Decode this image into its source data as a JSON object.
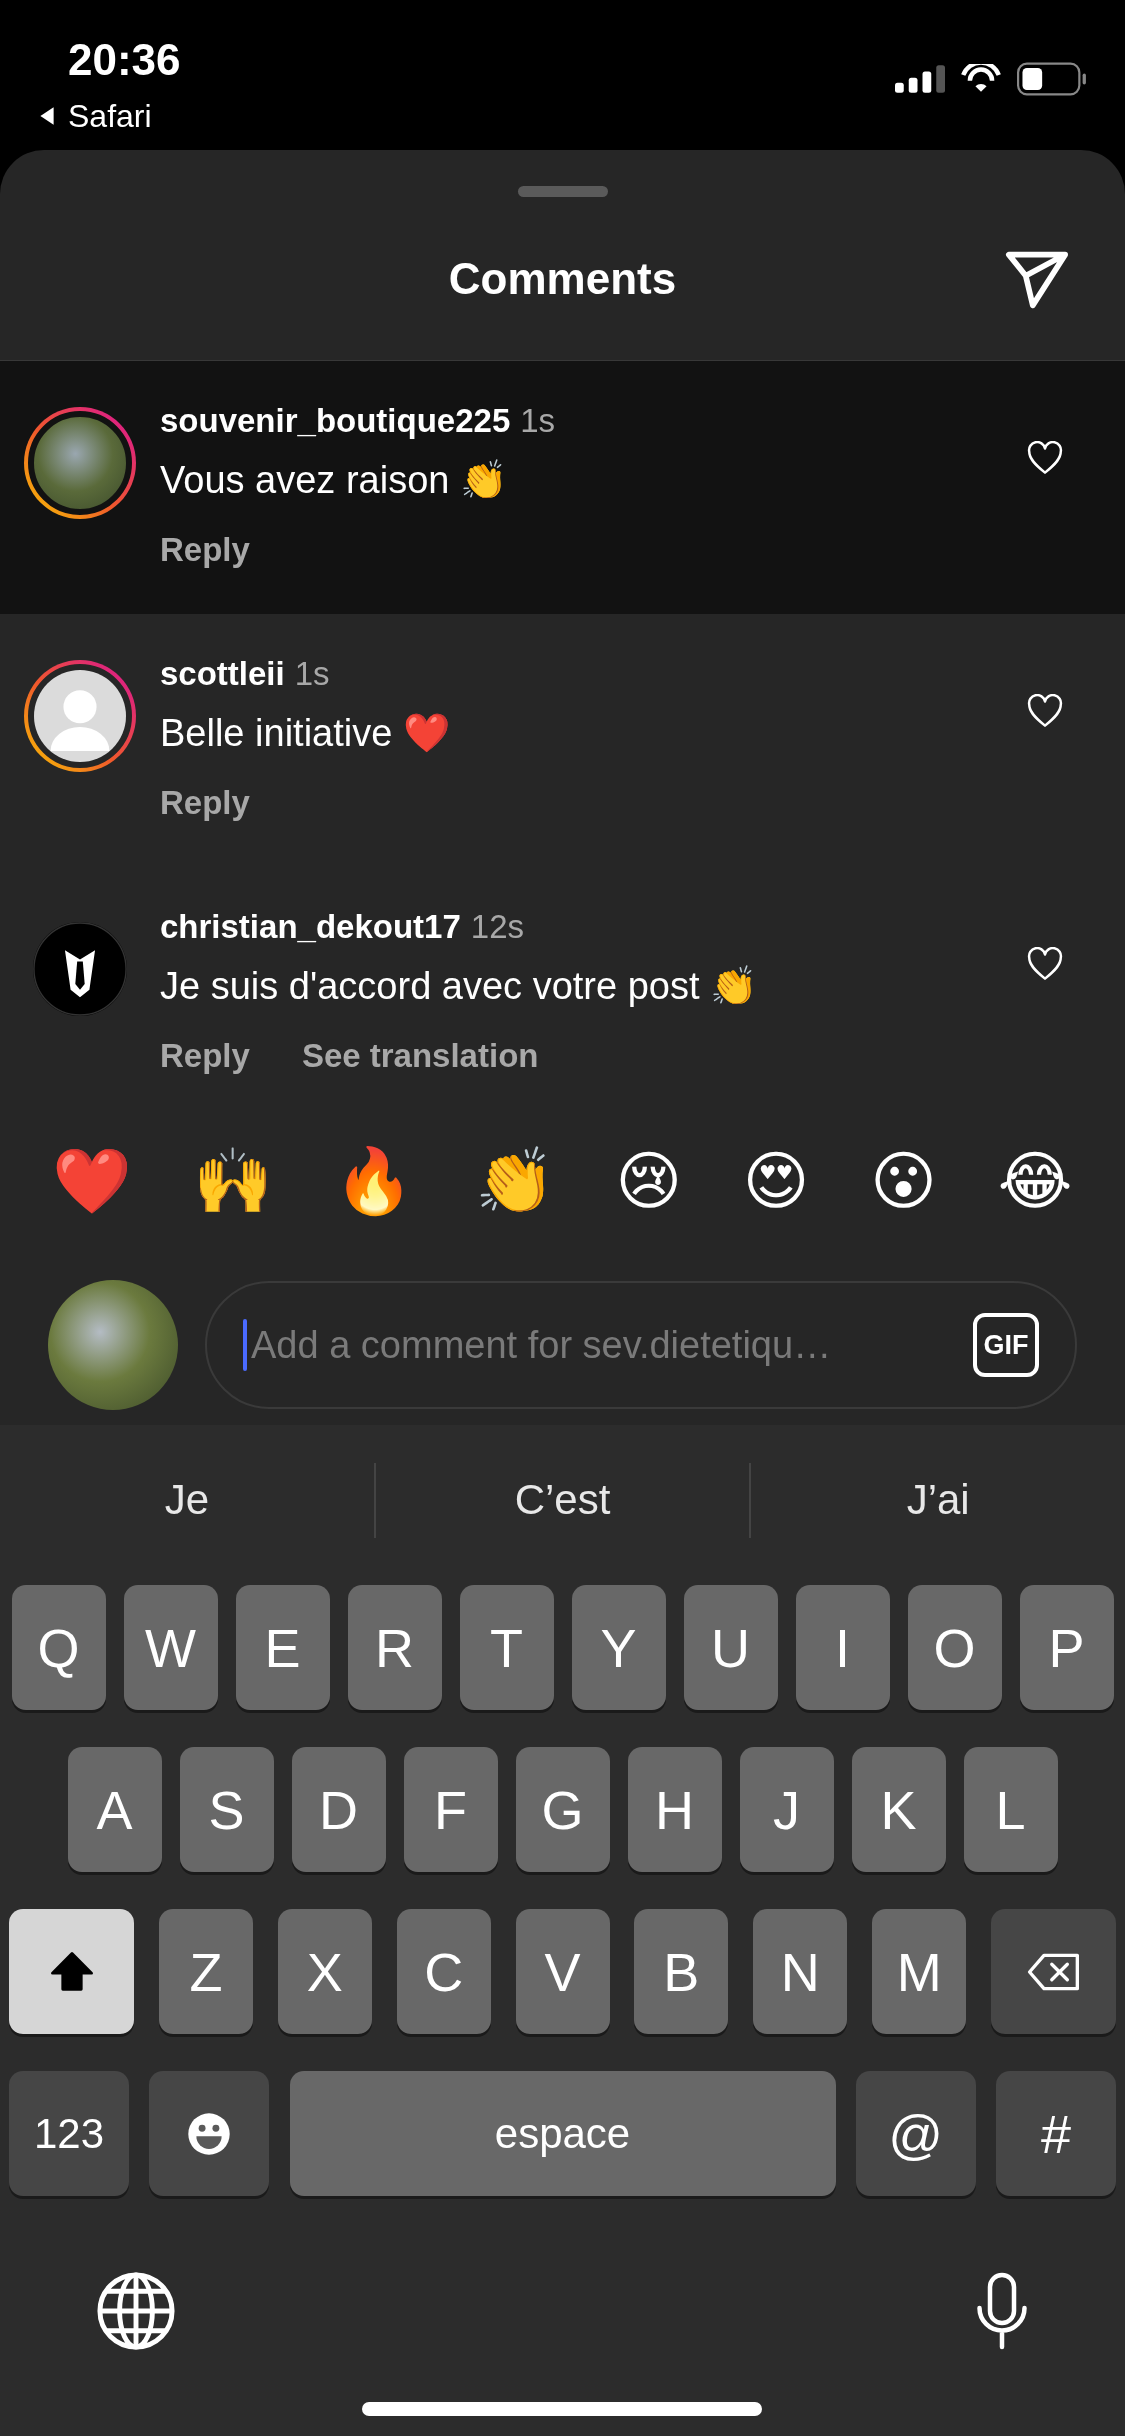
{
  "status_bar": {
    "time": "20:36",
    "back_app": "Safari"
  },
  "sheet": {
    "title": "Comments"
  },
  "comments": [
    {
      "username": "souvenir_boutique225",
      "time": "1s",
      "text": "Vous avez raison 👏",
      "actions": [
        "Reply"
      ],
      "highlighted": true,
      "avatar": {
        "kind": "photo"
      },
      "story_ring": true
    },
    {
      "username": "scottleii",
      "time": "1s",
      "text": "Belle initiative ❤️",
      "actions": [
        "Reply"
      ],
      "highlighted": false,
      "avatar": {
        "kind": "default"
      },
      "story_ring": true
    },
    {
      "username": "christian_dekout17",
      "time": "12s",
      "text": "Je suis d'accord avec votre post 👏",
      "actions": [
        "Reply",
        "See translation"
      ],
      "highlighted": false,
      "avatar": {
        "kind": "logo"
      },
      "story_ring": false
    }
  ],
  "reactions": [
    "❤️",
    "🙌",
    "🔥",
    "👏",
    "😢",
    "😍",
    "😮",
    "😂"
  ],
  "composer": {
    "placeholder": "Add a comment for sev.dietetiqu…",
    "gif_label": "GIF"
  },
  "keyboard": {
    "suggestions": [
      "Je",
      "C’est",
      "J’ai"
    ],
    "rows": [
      {
        "keys": [
          {
            "kind": "letter",
            "label": "Q"
          },
          {
            "kind": "letter",
            "label": "W"
          },
          {
            "kind": "letter",
            "label": "E"
          },
          {
            "kind": "letter",
            "label": "R"
          },
          {
            "kind": "letter",
            "label": "T"
          },
          {
            "kind": "letter",
            "label": "Y"
          },
          {
            "kind": "letter",
            "label": "U"
          },
          {
            "kind": "letter",
            "label": "I"
          },
          {
            "kind": "letter",
            "label": "O"
          },
          {
            "kind": "letter",
            "label": "P"
          }
        ]
      },
      {
        "keys": [
          {
            "kind": "letter",
            "label": "A"
          },
          {
            "kind": "letter",
            "label": "S"
          },
          {
            "kind": "letter",
            "label": "D"
          },
          {
            "kind": "letter",
            "label": "F"
          },
          {
            "kind": "letter",
            "label": "G"
          },
          {
            "kind": "letter",
            "label": "H"
          },
          {
            "kind": "letter",
            "label": "J"
          },
          {
            "kind": "letter",
            "label": "K"
          },
          {
            "kind": "letter",
            "label": "L"
          }
        ]
      },
      {
        "keys": [
          {
            "kind": "shift",
            "on": true
          },
          {
            "kind": "letter",
            "label": "Z"
          },
          {
            "kind": "letter",
            "label": "X"
          },
          {
            "kind": "letter",
            "label": "C"
          },
          {
            "kind": "letter",
            "label": "V"
          },
          {
            "kind": "letter",
            "label": "B"
          },
          {
            "kind": "letter",
            "label": "N"
          },
          {
            "kind": "letter",
            "label": "M"
          },
          {
            "kind": "delete"
          }
        ]
      },
      {
        "keys": [
          {
            "kind": "mode",
            "label": "123"
          },
          {
            "kind": "emoji"
          },
          {
            "kind": "space",
            "label": "espace"
          },
          {
            "kind": "symbol",
            "label": "@"
          },
          {
            "kind": "symbol",
            "label": "#"
          }
        ]
      }
    ]
  }
}
